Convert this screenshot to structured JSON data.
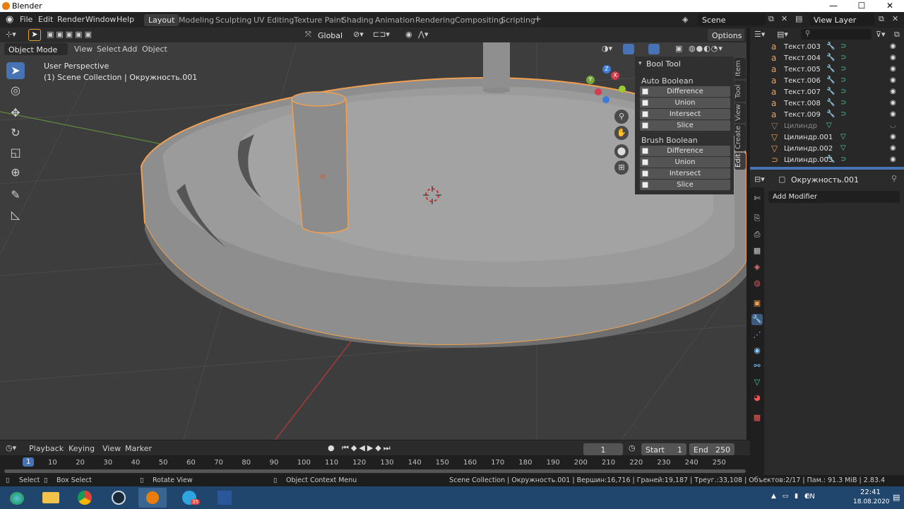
{
  "window": {
    "title": "Blender",
    "min": "—",
    "max": "☐",
    "close": "✕"
  },
  "menu": [
    "File",
    "Edit",
    "Render",
    "Window",
    "Help"
  ],
  "workspaces": [
    "Layout",
    "Modeling",
    "Sculpting",
    "UV Editing",
    "Texture Paint",
    "Shading",
    "Animation",
    "Rendering",
    "Compositing",
    "Scripting"
  ],
  "scene": {
    "label": "Scene",
    "view_layer": "View Layer"
  },
  "viewport_header": {
    "mode": "Object Mode",
    "menus": [
      "View",
      "Select",
      "Add",
      "Object"
    ],
    "orientation": "Global",
    "options": "Options"
  },
  "viewport": {
    "perspective": "User Perspective",
    "collection": "(1) Scene Collection | Окружность.001",
    "gizmo": {
      "x": "X",
      "y": "Y",
      "z": "Z"
    }
  },
  "bool_tool": {
    "title": "Bool Tool",
    "auto_label": "Auto Boolean",
    "brush_label": "Brush Boolean",
    "buttons": [
      "Difference",
      "Union",
      "Intersect",
      "Slice"
    ]
  },
  "sidebar_tabs": [
    "Item",
    "Tool",
    "View",
    "Create",
    "Edit"
  ],
  "outliner": {
    "items": [
      {
        "name": "Текст.003",
        "type": "text"
      },
      {
        "name": "Текст.004",
        "type": "text"
      },
      {
        "name": "Текст.005",
        "type": "text"
      },
      {
        "name": "Текст.006",
        "type": "text"
      },
      {
        "name": "Текст.007",
        "type": "text"
      },
      {
        "name": "Текст.008",
        "type": "text"
      },
      {
        "name": "Текст.009",
        "type": "text"
      },
      {
        "name": "Цилиндр",
        "type": "mesh"
      },
      {
        "name": "Цилиндр.001",
        "type": "mesh"
      },
      {
        "name": "Цилиндр.002",
        "type": "mesh"
      },
      {
        "name": "Цилиндр.003",
        "type": "curve"
      }
    ]
  },
  "properties": {
    "object_name": "Окружность.001",
    "add_modifier": "Add Modifier"
  },
  "timeline": {
    "menus": [
      "Playback",
      "Keying",
      "View",
      "Marker"
    ],
    "current_frame": "1",
    "start_label": "Start",
    "start": "1",
    "end_label": "End",
    "end": "250",
    "ticks": [
      "1",
      "10",
      "20",
      "30",
      "40",
      "50",
      "60",
      "70",
      "80",
      "90",
      "100",
      "110",
      "120",
      "130",
      "140",
      "150",
      "160",
      "170",
      "180",
      "190",
      "200",
      "210",
      "220",
      "230",
      "240",
      "250"
    ]
  },
  "statusbar": {
    "select": "Select",
    "box_select": "Box Select",
    "rotate_view": "Rotate View",
    "context_menu": "Object Context Menu",
    "stats": "Scene Collection | Окружность.001 | Вершин:16,716 | Граней:19,187 | Треуг.:33,108 | Объектов:2/17 | Пам.: 91.3 MiB | 2.83.4"
  },
  "taskbar": {
    "lang": "EN",
    "time": "22:41",
    "date": "18.08.2020",
    "badge": "35",
    "colors": {
      "bar": "#21466e",
      "accent": "#4772b3",
      "selection": "#f0a050"
    }
  }
}
